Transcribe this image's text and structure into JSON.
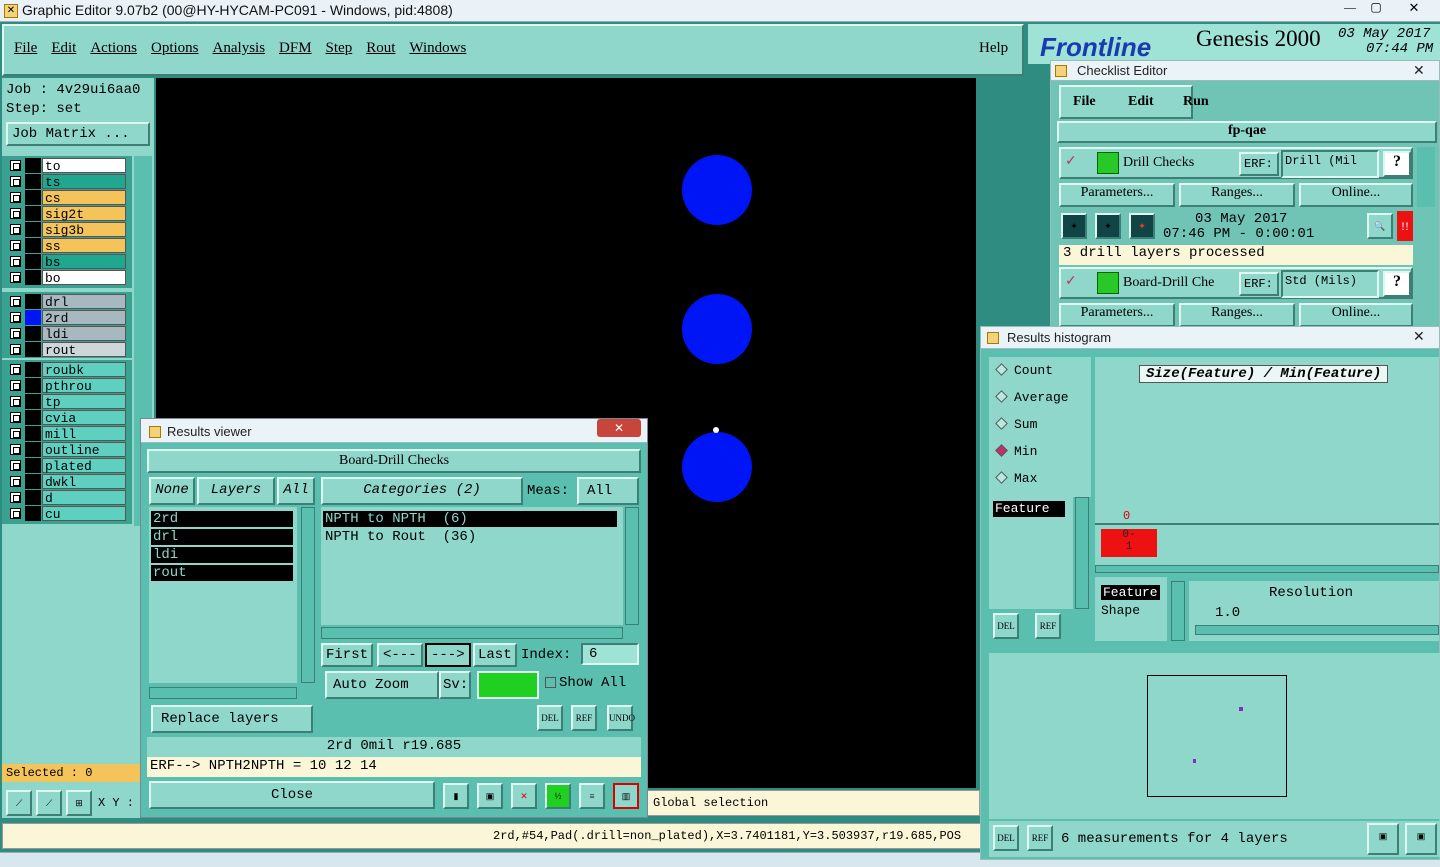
{
  "app": {
    "title": "Graphic Editor 9.07b2 (00@HY-HYCAM-PC091 - Windows, pid:4808)",
    "min": "—",
    "max": "▢",
    "close": "✕"
  },
  "menu": {
    "items": [
      "File",
      "Edit",
      "Actions",
      "Options",
      "Analysis",
      "DFM",
      "Step",
      "Rout",
      "Windows"
    ],
    "help": "Help"
  },
  "brand": {
    "logo": "Frontline",
    "product": "Genesis 2000",
    "date": "03 May 2017",
    "time": "07:44 PM"
  },
  "job": {
    "job": "Job : 4v29ui6aa0",
    "step": "Step: set",
    "matrix": "Job Matrix ..."
  },
  "layers": {
    "group1": [
      {
        "name": "to",
        "color": "#ffffff"
      },
      {
        "name": "ts",
        "color": "#1fa88f"
      },
      {
        "name": "cs",
        "color": "#f4c35a"
      },
      {
        "name": "sig2t",
        "color": "#f4c35a"
      },
      {
        "name": "sig3b",
        "color": "#f4c35a"
      },
      {
        "name": "ss",
        "color": "#f4c35a"
      },
      {
        "name": "bs",
        "color": "#1fa88f"
      },
      {
        "name": "bo",
        "color": "#ffffff"
      }
    ],
    "group2": [
      {
        "name": "drl",
        "color": "#a8b8c0"
      },
      {
        "name": "2rd",
        "color": "#a8b8c0"
      },
      {
        "name": "ldi",
        "color": "#a8b8c0"
      },
      {
        "name": "rout",
        "color": "#cfd6da"
      }
    ],
    "group3": [
      {
        "name": "roubk",
        "color": "#5fd0c0"
      },
      {
        "name": "pthrou",
        "color": "#5fd0c0"
      },
      {
        "name": "tp",
        "color": "#5fd0c0"
      },
      {
        "name": "cvia",
        "color": "#5fd0c0"
      },
      {
        "name": "mill",
        "color": "#5fd0c0"
      },
      {
        "name": "outline",
        "color": "#5fd0c0"
      },
      {
        "name": "plated",
        "color": "#5fd0c0"
      },
      {
        "name": "dwkl",
        "color": "#5fd0c0"
      },
      {
        "name": "d",
        "color": "#5fd0c0"
      },
      {
        "name": "cu",
        "color": "#5fd0c0"
      }
    ]
  },
  "selected": "Selected : 0",
  "xy_label": "X Y :",
  "status": {
    "global": "Global selection",
    "bottom": "2rd,#54,Pad(.drill=non_plated),X=3.7401181,Y=3.503937,r19.685,POS"
  },
  "checklist": {
    "title": "Checklist Editor",
    "menu": [
      "File",
      "Edit",
      "Run"
    ],
    "name": "fp-qae",
    "check1": {
      "name": "Drill Checks",
      "erf_label": "ERF:",
      "erf": "Drill (Mil",
      "help": "?",
      "params": "Parameters...",
      "ranges": "Ranges...",
      "online": "Online...",
      "date": "03 May 2017",
      "time": "07:46 PM - 0:00:01",
      "msg": "3 drill layers processed",
      "alert": "!!"
    },
    "check2": {
      "name": "Board-Drill Che",
      "erf_label": "ERF:",
      "erf": "Std (Mils)",
      "help": "?",
      "params": "Parameters...",
      "ranges": "Ranges...",
      "online": "Online..."
    }
  },
  "histogram": {
    "title": "Results histogram",
    "close": "✕",
    "options": [
      "Count",
      "Average",
      "Sum",
      "Min",
      "Max"
    ],
    "selected": "Min",
    "header": "Size(Feature) / Min(Feature)",
    "list_item": "Feature",
    "bar_count": "0",
    "bar_label": "0-\n1",
    "feature": "Feature",
    "shape": "Shape",
    "resolution_label": "Resolution",
    "resolution": "1.0",
    "del": "DEL",
    "ref": "REF",
    "measurements": "6 measurements for 4 layers"
  },
  "viewer": {
    "title": "Results viewer",
    "close": "✕",
    "check": "Board-Drill Checks",
    "none": "None",
    "layers": "Layers",
    "all": "All",
    "categories": "Categories (2)",
    "meas_label": "Meas:",
    "meas": "All",
    "layer_list": [
      "2rd",
      "drl",
      "ldi",
      "rout"
    ],
    "cat_list": [
      "NPTH to NPTH  (6)",
      "NPTH to Rout  (36)"
    ],
    "first": "First",
    "prev": "<---",
    "next": "--->",
    "last": "Last",
    "index_label": "Index:",
    "index": "6",
    "auto_zoom": "Auto Zoom",
    "sv": "Sv:",
    "show_all": "Show All",
    "replace": "Replace layers",
    "del": "DEL",
    "ref": "REF",
    "undo": "UNDO",
    "info": "2rd  0mil  r19.685",
    "erf": "ERF--> NPTH2NPTH = 10 12 14",
    "close_btn": "Close"
  },
  "colors": {
    "canvas": "#000000",
    "pad": "#0015f5",
    "panel": "#8fd7cb"
  }
}
